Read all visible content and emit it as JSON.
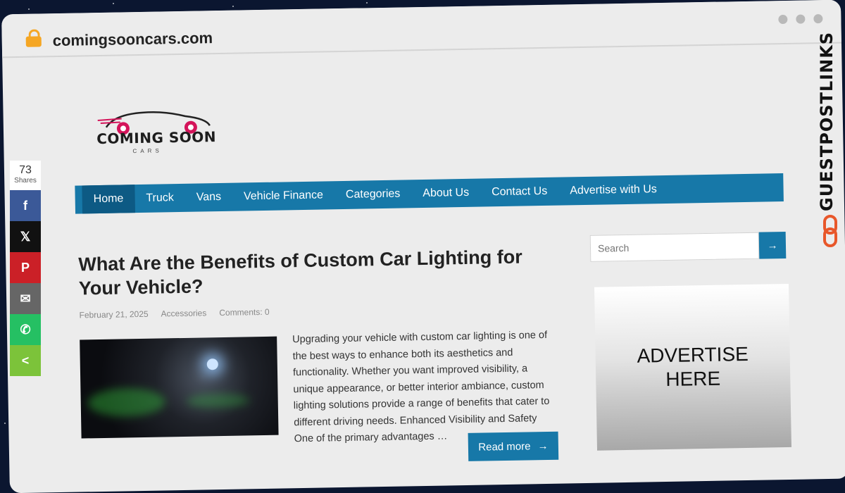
{
  "browser": {
    "url": "comingsooncars.com"
  },
  "logo": {
    "text": "COMING SOON",
    "subtext": "CARS"
  },
  "nav": {
    "items": [
      {
        "label": "Home",
        "active": true
      },
      {
        "label": "Truck"
      },
      {
        "label": "Vans"
      },
      {
        "label": "Vehicle Finance"
      },
      {
        "label": "Categories"
      },
      {
        "label": "About Us"
      },
      {
        "label": "Contact Us"
      },
      {
        "label": "Advertise with Us"
      }
    ]
  },
  "post": {
    "title": "What Are the Benefits of Custom Car Lighting for Your Vehicle?",
    "date": "February 21, 2025",
    "category": "Accessories",
    "comments": "Comments: 0",
    "excerpt": "Upgrading your vehicle with custom car lighting is one of the best ways to enhance both its aesthetics and functionality. Whether you want improved visibility, a unique appearance, or better interior ambiance, custom lighting solutions provide a range of benefits that cater to different driving needs. Enhanced Visibility and Safety One of the primary advantages …",
    "read_more": "Read more",
    "read_more_arrow": "→"
  },
  "sidebar": {
    "search_placeholder": "Search",
    "search_button": "→",
    "ad_text": "ADVERTISE HERE"
  },
  "share": {
    "count": "73",
    "label": "Shares",
    "buttons": [
      {
        "name": "facebook",
        "glyph": "f"
      },
      {
        "name": "x",
        "glyph": "𝕏"
      },
      {
        "name": "pinterest",
        "glyph": "P"
      },
      {
        "name": "email",
        "glyph": "✉"
      },
      {
        "name": "whatsapp",
        "glyph": "✆"
      },
      {
        "name": "share",
        "glyph": "<"
      }
    ]
  },
  "brand": {
    "text": "GUESTPOSTLINKS"
  },
  "colors": {
    "nav": "#1778a8",
    "nav_active": "#0d5a84",
    "accent": "#1778a8",
    "brand_orange": "#e8572a"
  }
}
